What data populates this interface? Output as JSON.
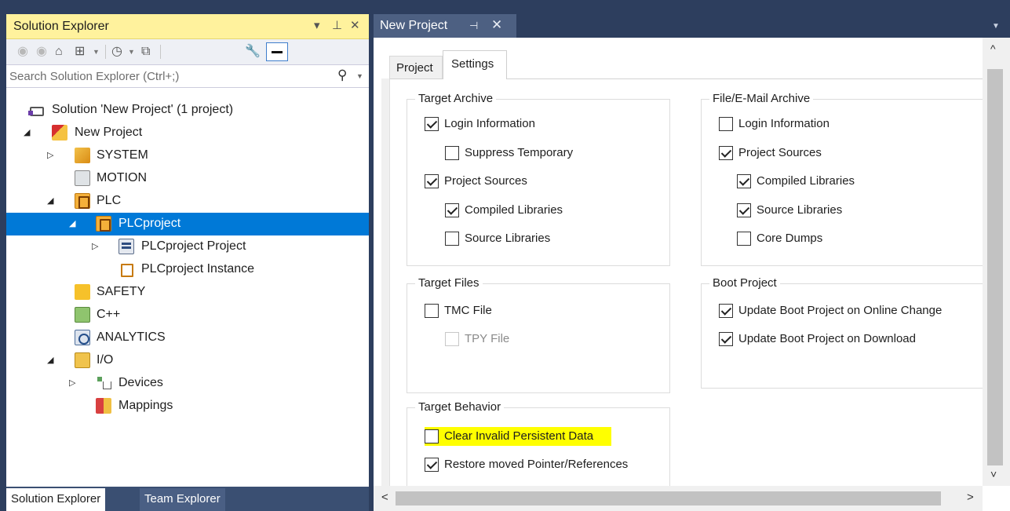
{
  "solution_explorer": {
    "title": "Solution Explorer",
    "title_controls": {
      "dropdown": "▾",
      "pin": "⊥",
      "close": "✕"
    },
    "toolbar_icons": [
      "back-icon",
      "forward-icon",
      "home-icon",
      "switch-views-icon",
      "history-icon",
      "collapse-all-icon",
      "properties-icon",
      "pin-preview-icon"
    ],
    "search": {
      "placeholder": "Search Solution Explorer (Ctrl+;)"
    },
    "tree": [
      {
        "label": "Solution 'New Project' (1 project)",
        "icon": "solution-icon",
        "expander": ""
      },
      {
        "label": "New Project",
        "icon": "twincat-project-icon",
        "expander": "◢"
      },
      {
        "label": "SYSTEM",
        "icon": "system-icon",
        "expander": "▷"
      },
      {
        "label": "MOTION",
        "icon": "motion-icon",
        "expander": ""
      },
      {
        "label": "PLC",
        "icon": "plc-icon",
        "expander": "◢"
      },
      {
        "label": "PLCproject",
        "icon": "plc-project-icon",
        "expander": "◢",
        "selected": true
      },
      {
        "label": "PLCproject Project",
        "icon": "plc-project-file-icon",
        "expander": "▷"
      },
      {
        "label": "PLCproject Instance",
        "icon": "plc-instance-icon",
        "expander": ""
      },
      {
        "label": "SAFETY",
        "icon": "safety-icon",
        "expander": ""
      },
      {
        "label": "C++",
        "icon": "cpp-icon",
        "expander": ""
      },
      {
        "label": "ANALYTICS",
        "icon": "analytics-icon",
        "expander": ""
      },
      {
        "label": "I/O",
        "icon": "io-icon",
        "expander": "◢"
      },
      {
        "label": "Devices",
        "icon": "devices-icon",
        "expander": "▷"
      },
      {
        "label": "Mappings",
        "icon": "mappings-icon",
        "expander": ""
      }
    ],
    "bottom_tabs": {
      "active": "Solution Explorer",
      "inactive": "Team Explorer"
    }
  },
  "document_tab": {
    "title": "New Project",
    "pin": "⊣",
    "close": "✕",
    "menu": "▼"
  },
  "editor": {
    "tabs": {
      "project": "Project",
      "settings": "Settings"
    },
    "groups": {
      "target_archive": {
        "title": "Target Archive",
        "items": [
          {
            "label": "Login Information",
            "checked": true
          },
          {
            "label": "Suppress Temporary",
            "checked": false
          },
          {
            "label": "Project Sources",
            "checked": true
          },
          {
            "label": "Compiled Libraries",
            "checked": true
          },
          {
            "label": "Source Libraries",
            "checked": false
          }
        ]
      },
      "file_archive": {
        "title": "File/E-Mail Archive",
        "items": [
          {
            "label": "Login Information",
            "checked": false
          },
          {
            "label": "Project Sources",
            "checked": true
          },
          {
            "label": "Compiled Libraries",
            "checked": true
          },
          {
            "label": "Source Libraries",
            "checked": true
          },
          {
            "label": "Core Dumps",
            "checked": false
          }
        ]
      },
      "target_files": {
        "title": "Target Files",
        "items": [
          {
            "label": "TMC File",
            "checked": false
          },
          {
            "label": "TPY File",
            "checked": false,
            "disabled": true
          }
        ]
      },
      "boot_project": {
        "title": "Boot Project",
        "items": [
          {
            "label": "Update Boot Project on Online Change",
            "checked": true
          },
          {
            "label": "Update Boot Project on Download",
            "checked": true
          }
        ]
      },
      "target_behavior": {
        "title": "Target Behavior",
        "items": [
          {
            "label": "Clear Invalid Persistent Data",
            "checked": false,
            "highlighted": true
          },
          {
            "label": "Restore moved Pointer/References",
            "checked": true
          }
        ]
      }
    },
    "scroll": {
      "up": "^",
      "down": "˅",
      "left": "<",
      "right": ">"
    }
  },
  "colors": {
    "title_bar_active": "#fff29d",
    "selection": "#0079d7",
    "ide_frame": "#2d3e5e",
    "highlight": "#ffff00"
  }
}
